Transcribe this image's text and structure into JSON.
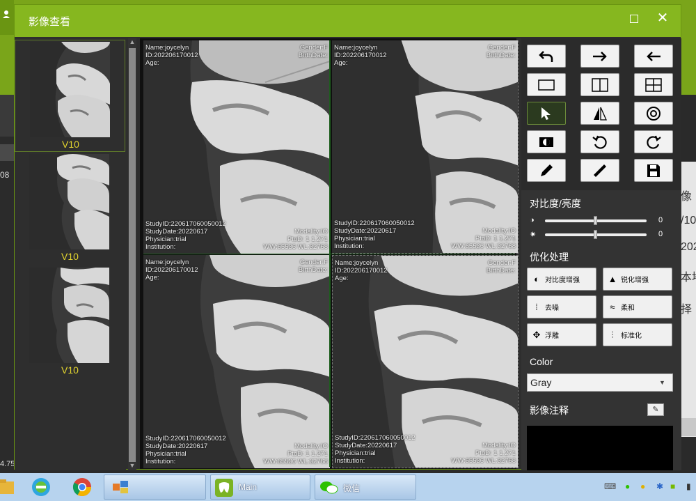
{
  "window": {
    "title": "影像查看",
    "close_glyph": "✕"
  },
  "background": {
    "left_number": "08",
    "left_bottom": "4.75",
    "right_texts": [
      "像",
      "/10",
      "202",
      "本地",
      "择"
    ]
  },
  "thumbnails": [
    {
      "label": "V10",
      "selected": true
    },
    {
      "label": "V10",
      "selected": false
    },
    {
      "label": "V10",
      "selected": false
    }
  ],
  "scrollbar": {
    "up": "▲",
    "down": "▼"
  },
  "viewer": {
    "panes": [
      {
        "top_left": [
          "Name:joycelyn",
          "ID:202206170012",
          "Age:"
        ],
        "top_right": [
          "Gender:F",
          "BirthDate:"
        ],
        "bottom_left": [
          "StudyID:220617060050012",
          "StudyDate:20220617",
          "Physician:trial",
          "Institution:"
        ],
        "bottom_right": [
          "Modality:IO",
          "PtoD: 1   1.271",
          "WW:65536  WL:32768"
        ]
      },
      {
        "top_left": [
          "Name:joycelyn",
          "ID:202206170012",
          "Age:"
        ],
        "top_right": [
          "Gender:F",
          "BirthDate:"
        ],
        "bottom_left": [
          "StudyID:220617060050012",
          "StudyDate:20220617",
          "Physician:trial",
          "Institution:"
        ],
        "bottom_right": [
          "Modality:IO",
          "PtoD: 1   1.271",
          "WW:65536  WL:32768"
        ]
      },
      {
        "top_left": [
          "Name:joycelyn",
          "ID:202206170012",
          "Age:"
        ],
        "top_right": [
          "Gender:F",
          "BirthDate:"
        ],
        "bottom_left": [
          "StudyID:220617060050012",
          "StudyDate:20220617",
          "Physician:trial",
          "Institution:"
        ],
        "bottom_right": [
          "Modality:IO",
          "PtoD: 1   1.271",
          "WW:65536  WL:32768"
        ]
      },
      {
        "top_left": [
          "Name:joycelyn",
          "ID:202206170012",
          "Age:"
        ],
        "top_right": [
          "Gender:F",
          "BirthDate:"
        ],
        "bottom_left": [
          "StudyID:220617060050012",
          "StudyDate:20220617",
          "Physician:trial",
          "Institution:"
        ],
        "bottom_right": [
          "Modality:IO",
          "PtoD: 1   1.271",
          "WW:65536  WL:32768"
        ]
      }
    ]
  },
  "toolbar": {
    "buttons": [
      {
        "icon": "undo-icon"
      },
      {
        "icon": "arrow-right-icon"
      },
      {
        "icon": "arrow-left-icon"
      },
      {
        "icon": "layout-single-icon"
      },
      {
        "icon": "layout-two-col-icon"
      },
      {
        "icon": "layout-grid-icon"
      },
      {
        "icon": "pointer-icon",
        "active": true
      },
      {
        "icon": "flip-icon"
      },
      {
        "icon": "circle-target-icon"
      },
      {
        "icon": "invert-icon"
      },
      {
        "icon": "rotate-left-icon"
      },
      {
        "icon": "rotate-right-icon"
      },
      {
        "icon": "pencil-icon"
      },
      {
        "icon": "ruler-icon"
      },
      {
        "icon": "save-icon"
      }
    ]
  },
  "adjust": {
    "title": "对比度/亮度",
    "contrast": {
      "icon": "◑",
      "value": "0",
      "level": 0.5
    },
    "brightness": {
      "icon": "✷",
      "value": "0",
      "level": 0.5
    }
  },
  "optimize": {
    "title": "优化处理",
    "buttons": [
      {
        "label": "对比度增强",
        "icon": "contrast-enhance-icon",
        "glyph": "◐"
      },
      {
        "label": "锐化增强",
        "icon": "sharpen-icon",
        "glyph": "▲"
      },
      {
        "label": "去噪",
        "icon": "denoise-icon",
        "glyph": "⦙"
      },
      {
        "label": "柔和",
        "icon": "soften-icon",
        "glyph": "≈"
      },
      {
        "label": "浮雕",
        "icon": "emboss-icon",
        "glyph": "✥"
      },
      {
        "label": "标准化",
        "icon": "normalize-icon",
        "glyph": "⫶"
      }
    ]
  },
  "color": {
    "title": "Color",
    "selected": "Gray",
    "arrow": "▼"
  },
  "notes": {
    "title": "影像注释",
    "edit_glyph": "✎"
  },
  "taskbar": {
    "apps": [
      {
        "icon": "folder-icon"
      },
      {
        "icon": "ie-icon"
      },
      {
        "icon": "chrome-icon"
      },
      {
        "icon": "explorer-window-icon"
      },
      {
        "icon": "dental-app-icon",
        "label": "Main"
      },
      {
        "icon": "wechat-icon",
        "label": "微信"
      }
    ]
  }
}
